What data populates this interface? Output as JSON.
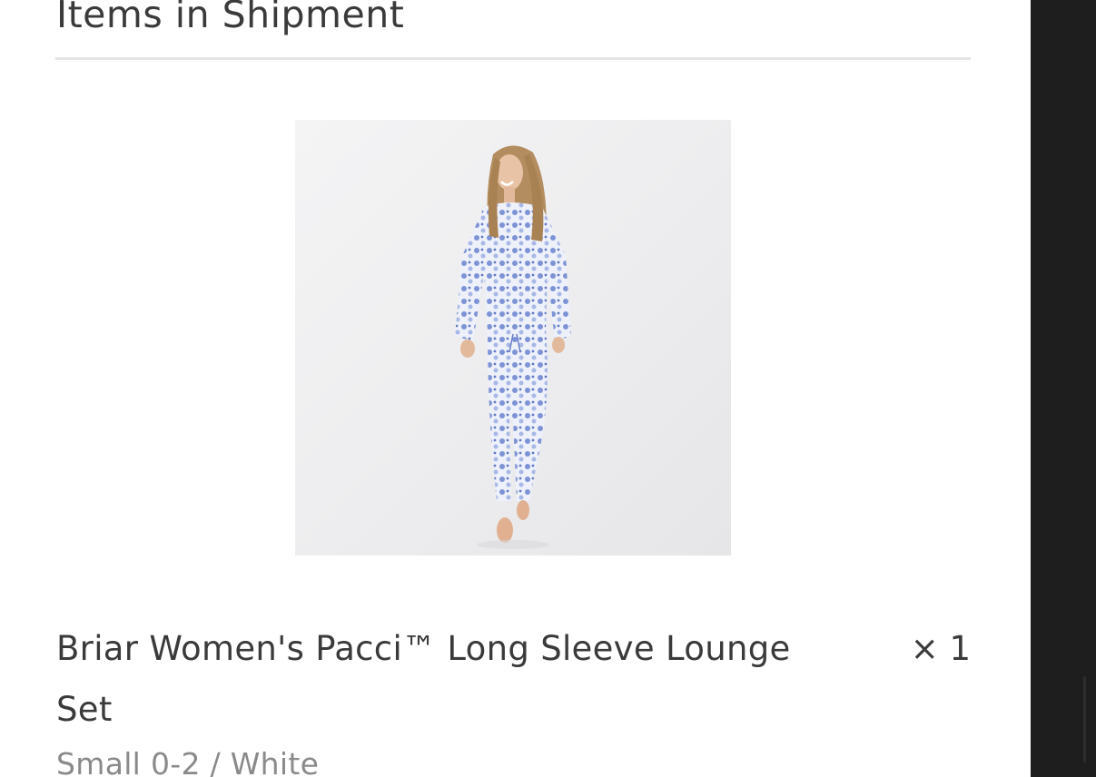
{
  "shipment": {
    "title": "Items in Shipment",
    "items": [
      {
        "name": "Briar Women's Pacci™ Long Sleeve Lounge Set",
        "quantity": "× 1",
        "variant": "Small 0-2 / White",
        "image_icon": "product-photo-icon"
      }
    ]
  },
  "colors": {
    "text": "#3a3a3a",
    "muted_text": "#8a8a8a",
    "divider": "#e5e5e5",
    "sidebar": "#1e1e1f"
  }
}
